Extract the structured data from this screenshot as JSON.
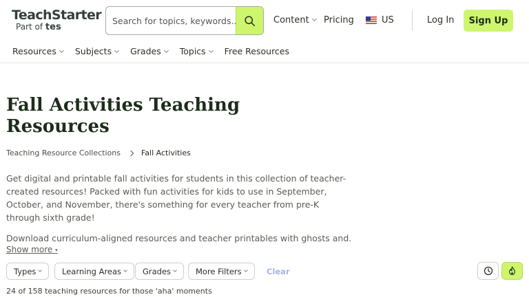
{
  "brand": {
    "name": "TeachStarter",
    "sub_prefix": "Part of",
    "sub_brand": "tes"
  },
  "search": {
    "placeholder": "Search for topics, keywords..."
  },
  "topnav": {
    "content": "Content",
    "pricing": "Pricing",
    "region": "US",
    "login": "Log In",
    "signup": "Sign Up"
  },
  "subnav": {
    "items": [
      {
        "label": "Resources"
      },
      {
        "label": "Subjects"
      },
      {
        "label": "Grades"
      },
      {
        "label": "Topics"
      },
      {
        "label": "Free Resources"
      }
    ]
  },
  "page": {
    "title": "Fall Activities Teaching Resources",
    "breadcrumb": {
      "parent": "Teaching Resource Collections",
      "current": "Fall Activities"
    },
    "description": "Get digital and printable fall activities for students in this collection of teacher-created resources! Packed with fun activities for kids to use in September, October, and November, there's something for every teacher from pre-K through sixth grade!",
    "description_2": "Download curriculum-aligned resources and teacher printables with ghosts and...",
    "show_more": "Show more"
  },
  "filters": {
    "types": "Types",
    "learning_areas": "Learning Areas",
    "grades": "Grades",
    "more": "More Filters",
    "clear": "Clear"
  },
  "results": {
    "text": "24 of 158 teaching resources for those 'aha' moments"
  },
  "colors": {
    "accent": "#cdf56d",
    "heading": "#1d2d1a",
    "clear_link": "#a9b2e8"
  },
  "icons": {
    "search": "search-icon",
    "recent": "clock-icon",
    "popular": "flame-icon"
  }
}
